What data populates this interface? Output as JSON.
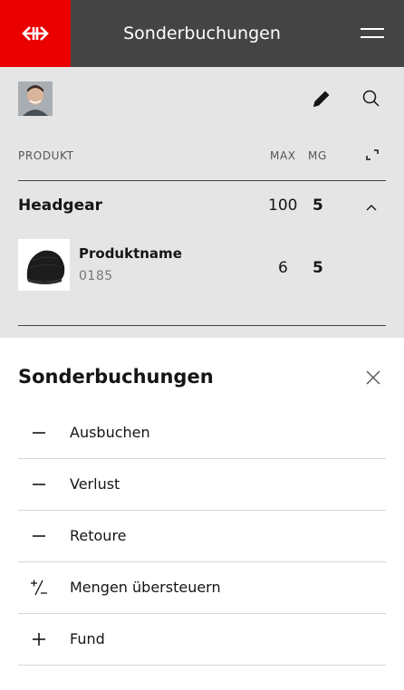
{
  "header": {
    "title": "Sonderbuchungen",
    "brand_color": "#eb0000",
    "bar_color": "#444444",
    "logo_icon": "sbb-arrows-icon",
    "menu_icon": "hamburger-icon"
  },
  "toolbar": {
    "edit_icon": "pencil-icon",
    "search_icon": "search-icon"
  },
  "table": {
    "columns": {
      "product": "PRODUKT",
      "max": "MAX",
      "mg": "MG"
    },
    "expand_icon": "expand-icon",
    "group": {
      "name": "Headgear",
      "max": "100",
      "mg": "5",
      "toggle_icon": "chevron-up-icon"
    },
    "items": [
      {
        "name": "Produktname",
        "number": "0185",
        "max": "6",
        "mg": "5",
        "image": "beanie-image"
      }
    ]
  },
  "sheet": {
    "title": "Sonderbuchungen",
    "close_icon": "close-icon",
    "options": [
      {
        "label": "Ausbuchen",
        "icon": "minus-icon"
      },
      {
        "label": "Verlust",
        "icon": "minus-icon"
      },
      {
        "label": "Retoure",
        "icon": "minus-icon"
      },
      {
        "label": "Mengen übersteuern",
        "icon": "plus-minus-icon"
      },
      {
        "label": "Fund",
        "icon": "plus-icon"
      }
    ]
  }
}
